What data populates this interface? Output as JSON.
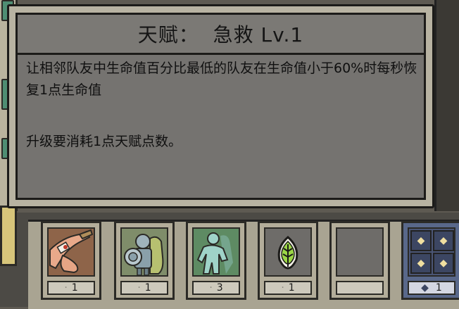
{
  "talent": {
    "title": "天赋：  急救 Lv.1",
    "description": "让相邻队友中生命值百分比最低的队友在生命值小于60%时每秒恢复1点生命值",
    "cost": "升级要消耗1点天赋点数。"
  },
  "slots": [
    {
      "icon": "bandaged-arm-icon",
      "count": "1"
    },
    {
      "icon": "armored-warriors-icon",
      "count": "1"
    },
    {
      "icon": "spirit-figures-icon",
      "count": "3"
    },
    {
      "icon": "green-leaf-icon",
      "count": "1"
    },
    {
      "icon": "empty-slot",
      "count": ""
    },
    {
      "icon": "diamond-grid-icon",
      "count": "1"
    }
  ],
  "colors": {
    "panel_bg": "#757370",
    "leaf_green": "#9bd646",
    "diamond_gold": "#f0dfa0"
  }
}
